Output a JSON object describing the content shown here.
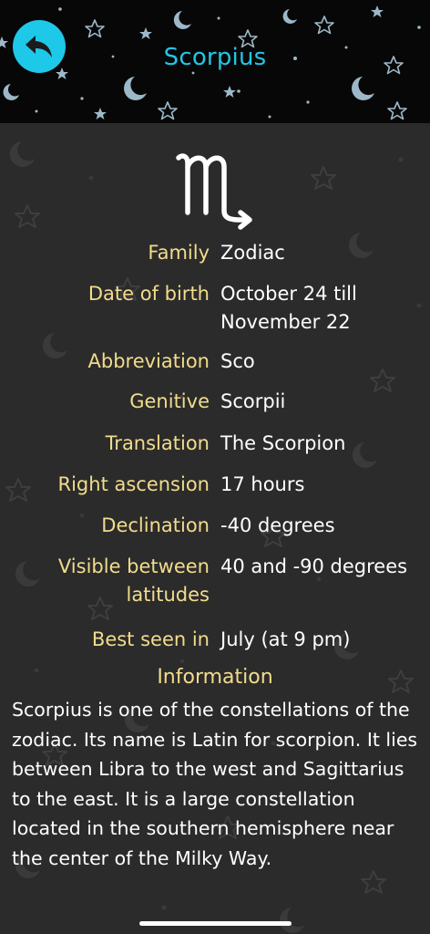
{
  "header": {
    "title": "Scorpius",
    "back_icon": "back-arrow-icon",
    "accent_color": "#1ec8e8"
  },
  "sign": {
    "icon": "scorpio-zodiac-icon",
    "color": "#ffffff"
  },
  "details": [
    {
      "label": "Family",
      "value": "Zodiac"
    },
    {
      "label": "Date of birth",
      "value": "October 24 till November 22"
    },
    {
      "label": "Abbreviation",
      "value": "Sco"
    },
    {
      "label": "Genitive",
      "value": "Scorpii"
    },
    {
      "label": "Translation",
      "value": "The Scorpion"
    },
    {
      "label": "Right ascension",
      "value": "17 hours"
    },
    {
      "label": "Declination",
      "value": "-40 degrees"
    },
    {
      "label": "Visible between latitudes",
      "value": "40 and -90 degrees"
    },
    {
      "label": "Best seen in",
      "value": "July (at 9 pm)"
    }
  ],
  "information": {
    "title": "Information",
    "text": "Scorpius is one of the constellations of the zodiac. Its name is Latin for scorpion. It lies between Libra to the west and Sagittarius to the east. It is a large constellation located in the southern hemisphere near the center of the Milky Way."
  },
  "colors": {
    "label": "#f2dc8c",
    "value": "#ffffff",
    "background": "#2b2b2b"
  }
}
